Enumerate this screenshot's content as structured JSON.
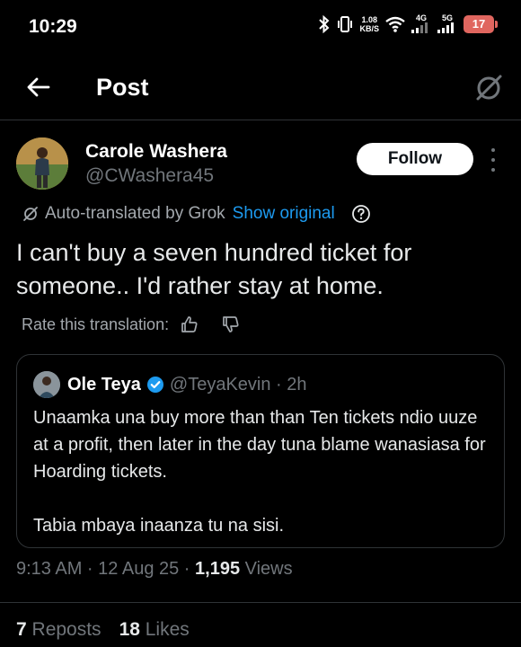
{
  "status_bar": {
    "time": "10:29",
    "speed_value": "1.08",
    "speed_unit": "KB/S",
    "network_1": "4G",
    "network_2": "5G",
    "battery": "17"
  },
  "header": {
    "title": "Post",
    "back_icon": "arrow-left-icon",
    "grok_icon": "grok-icon"
  },
  "post": {
    "author_name": "Carole Washera",
    "author_handle": "@CWashera45",
    "follow_label": "Follow",
    "translation_note": "Auto-translated by Grok",
    "show_original_label": "Show original",
    "text": "I can't buy a seven hundred ticket for someone.. I'd rather stay at home.",
    "rate_label": "Rate this translation:",
    "timestamp": "9:13 AM · 12 Aug 25 · ",
    "views_count": "1,195",
    "views_label": " Views",
    "reposts_count": "7",
    "reposts_label": " Reposts",
    "likes_count": "18",
    "likes_label": " Likes"
  },
  "quote": {
    "name": "Ole Teya",
    "handle_time": "@TeyaKevin · 2h",
    "text": "Unaamka una buy more than than Ten tickets ndio uuze at a profit, then later in the day tuna blame wanasiasa for Hoarding tickets.\n\nTabia mbaya inaanza tu na sisi."
  },
  "colors": {
    "background": "#000000",
    "accent": "#1d9bf0",
    "battery": "#e0665f"
  }
}
